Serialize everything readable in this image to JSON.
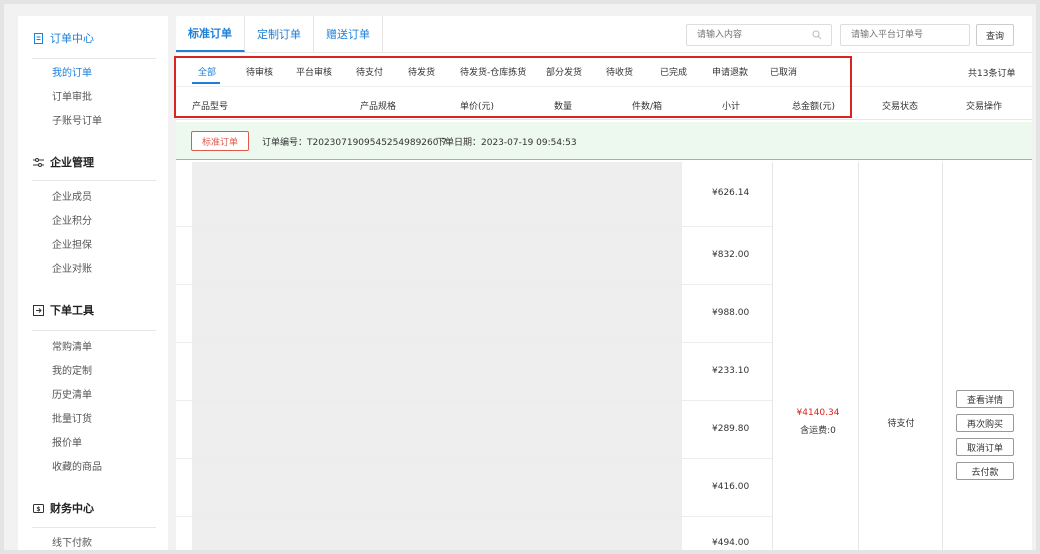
{
  "sidebar": {
    "sections": [
      {
        "title": "订单中心",
        "icon": "order-doc-icon",
        "items": [
          "我的订单",
          "订单审批",
          "子账号订单"
        ]
      },
      {
        "title": "企业管理",
        "icon": "settings-sliders-icon",
        "items": [
          "企业成员",
          "企业积分",
          "企业担保",
          "企业对账"
        ]
      },
      {
        "title": "下单工具",
        "icon": "order-tool-icon",
        "items": [
          "常购清单",
          "我的定制",
          "历史清单",
          "批量订货",
          "报价单",
          "收藏的商品"
        ]
      },
      {
        "title": "财务中心",
        "icon": "finance-icon",
        "items": [
          "线下付款"
        ]
      }
    ],
    "active_item": "我的订单"
  },
  "tabs": [
    "标准订单",
    "定制订单",
    "赠送订单"
  ],
  "search": {
    "content_placeholder": "请输入内容",
    "order_placeholder": "请输入平台订单号",
    "query_label": "查询"
  },
  "status_tabs": [
    "全部",
    "待审核",
    "平台审核",
    "待支付",
    "待发货",
    "待发货-仓库拣货",
    "部分发货",
    "待收货",
    "已完成",
    "申请退款",
    "已取消"
  ],
  "order_count": "共13条订单",
  "columns": [
    "产品型号",
    "产品规格",
    "单价(元)",
    "数量",
    "件数/箱",
    "小计",
    "总金额(元)",
    "交易状态",
    "交易操作"
  ],
  "order": {
    "badge": "标准订单",
    "order_no": "订单编号：T2023071909545254989260 7",
    "order_date": "下单日期：2023-07-19 09:54:53",
    "subtotals": [
      "¥626.14",
      "¥832.00",
      "¥988.00",
      "¥233.10",
      "¥289.80",
      "¥416.00",
      "¥494.00"
    ],
    "total": "¥4140.34",
    "freight": "含运费:0",
    "status": "待支付",
    "actions": [
      "查看详情",
      "再次购买",
      "取消订单",
      "去付款"
    ]
  },
  "colors": {
    "accent": "#1e7fd8",
    "highlight_box": "#d9251f",
    "order_bar": "#edf8ee"
  }
}
